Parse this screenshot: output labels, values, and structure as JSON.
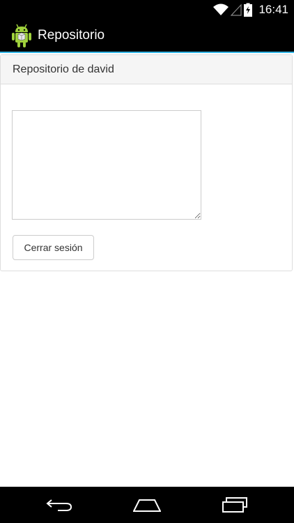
{
  "status_bar": {
    "time": "16:41",
    "icons": [
      "wifi-icon",
      "signal-icon",
      "battery-icon"
    ]
  },
  "action_bar": {
    "title": "Repositorio",
    "icon": "android-app-icon",
    "accent_color": "#33b5e5"
  },
  "panel": {
    "heading": "Repositorio de david",
    "textarea_value": "",
    "logout_label": "Cerrar sesión"
  },
  "nav_bar": {
    "icons": [
      "back-icon",
      "home-icon",
      "recent-apps-icon"
    ]
  }
}
